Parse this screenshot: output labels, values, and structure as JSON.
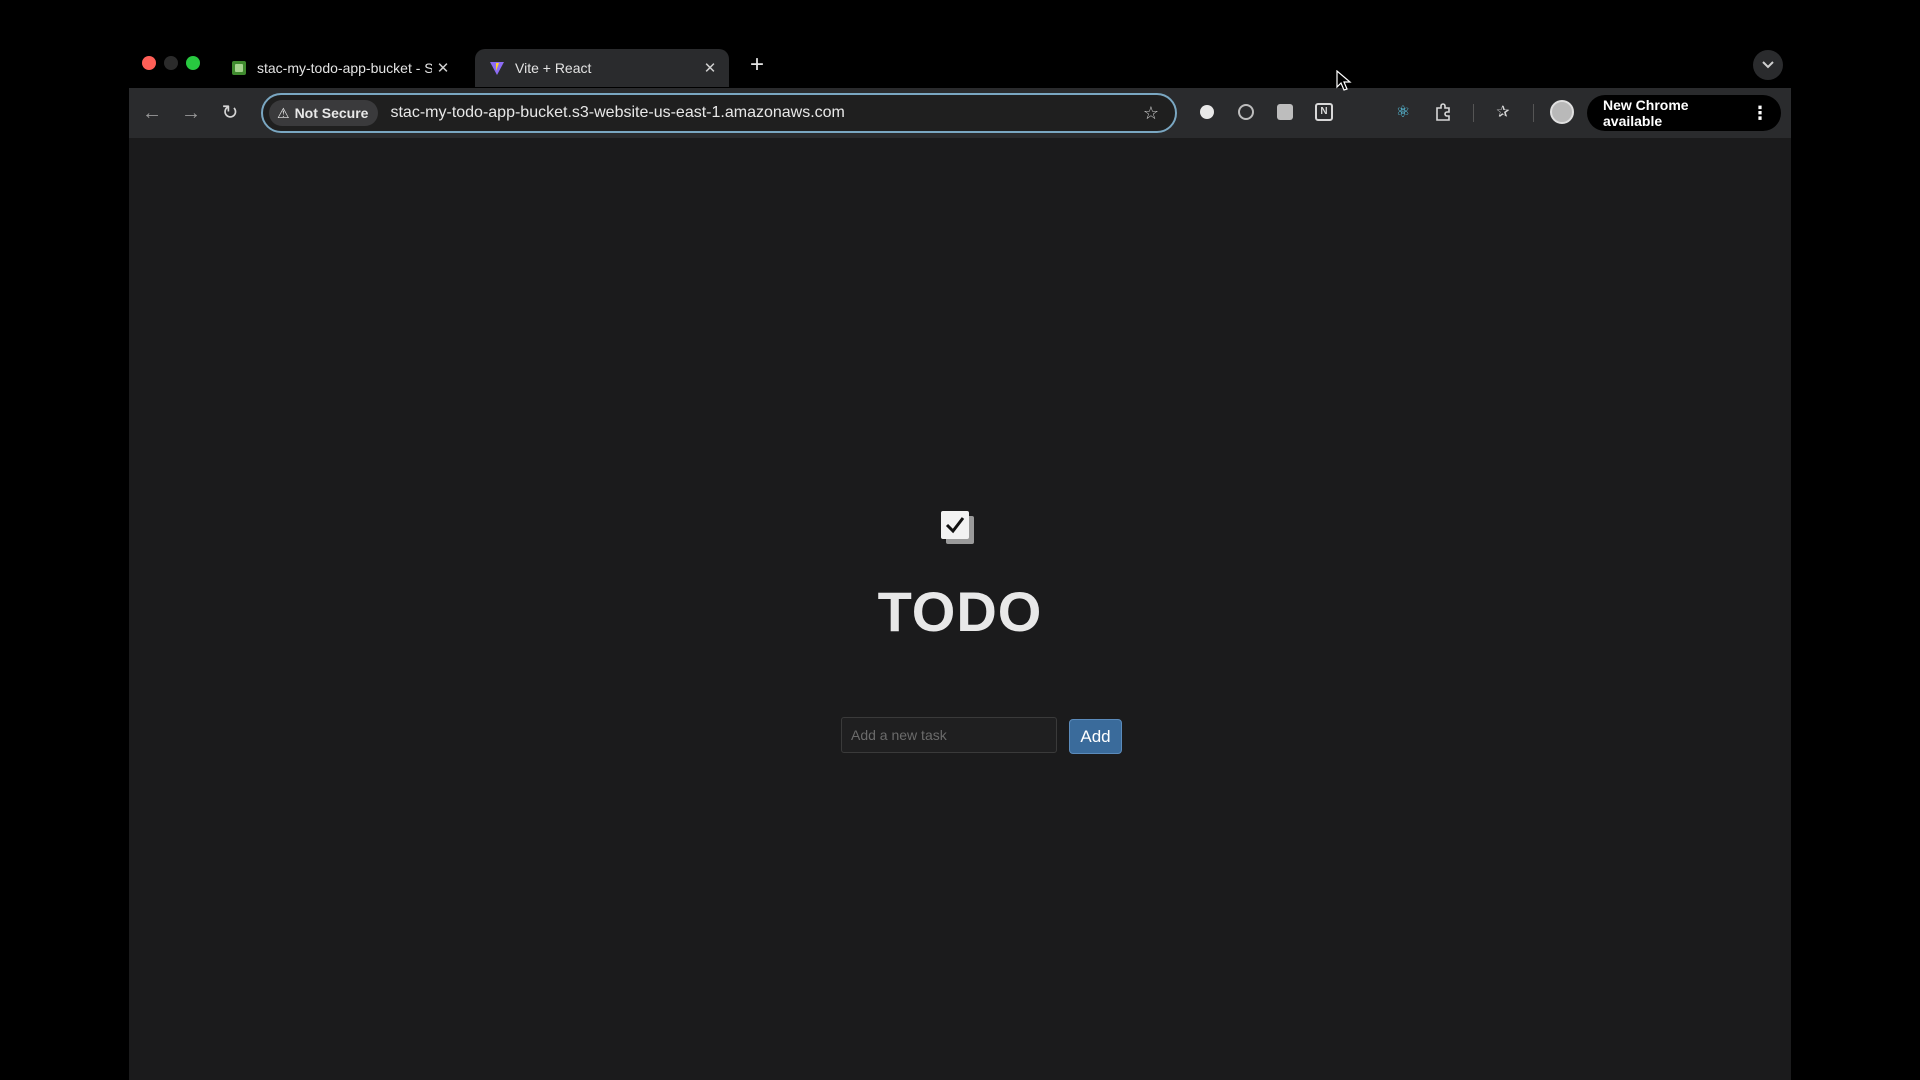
{
  "browser": {
    "tabs": [
      {
        "title": "stac-my-todo-app-bucket - S",
        "favicon": "s3-bucket-icon",
        "active": false
      },
      {
        "title": "Vite + React",
        "favicon": "vite-icon",
        "active": true
      }
    ],
    "new_tab_icon": "plus-icon",
    "address_bar": {
      "security_label": "Not Secure",
      "url": "stac-my-todo-app-bucket.s3-website-us-east-1.amazonaws.com"
    },
    "update_chip_label": "New Chrome available"
  },
  "app": {
    "logo_icon": "checkbox-checked-icon",
    "title": "TODO",
    "task_input": {
      "placeholder": "Add a new task",
      "value": ""
    },
    "add_button_label": "Add"
  },
  "colors": {
    "page_background": "#1b1b1c",
    "add_button": "#3a6b9b",
    "security_chip": "#3a3a3c"
  }
}
